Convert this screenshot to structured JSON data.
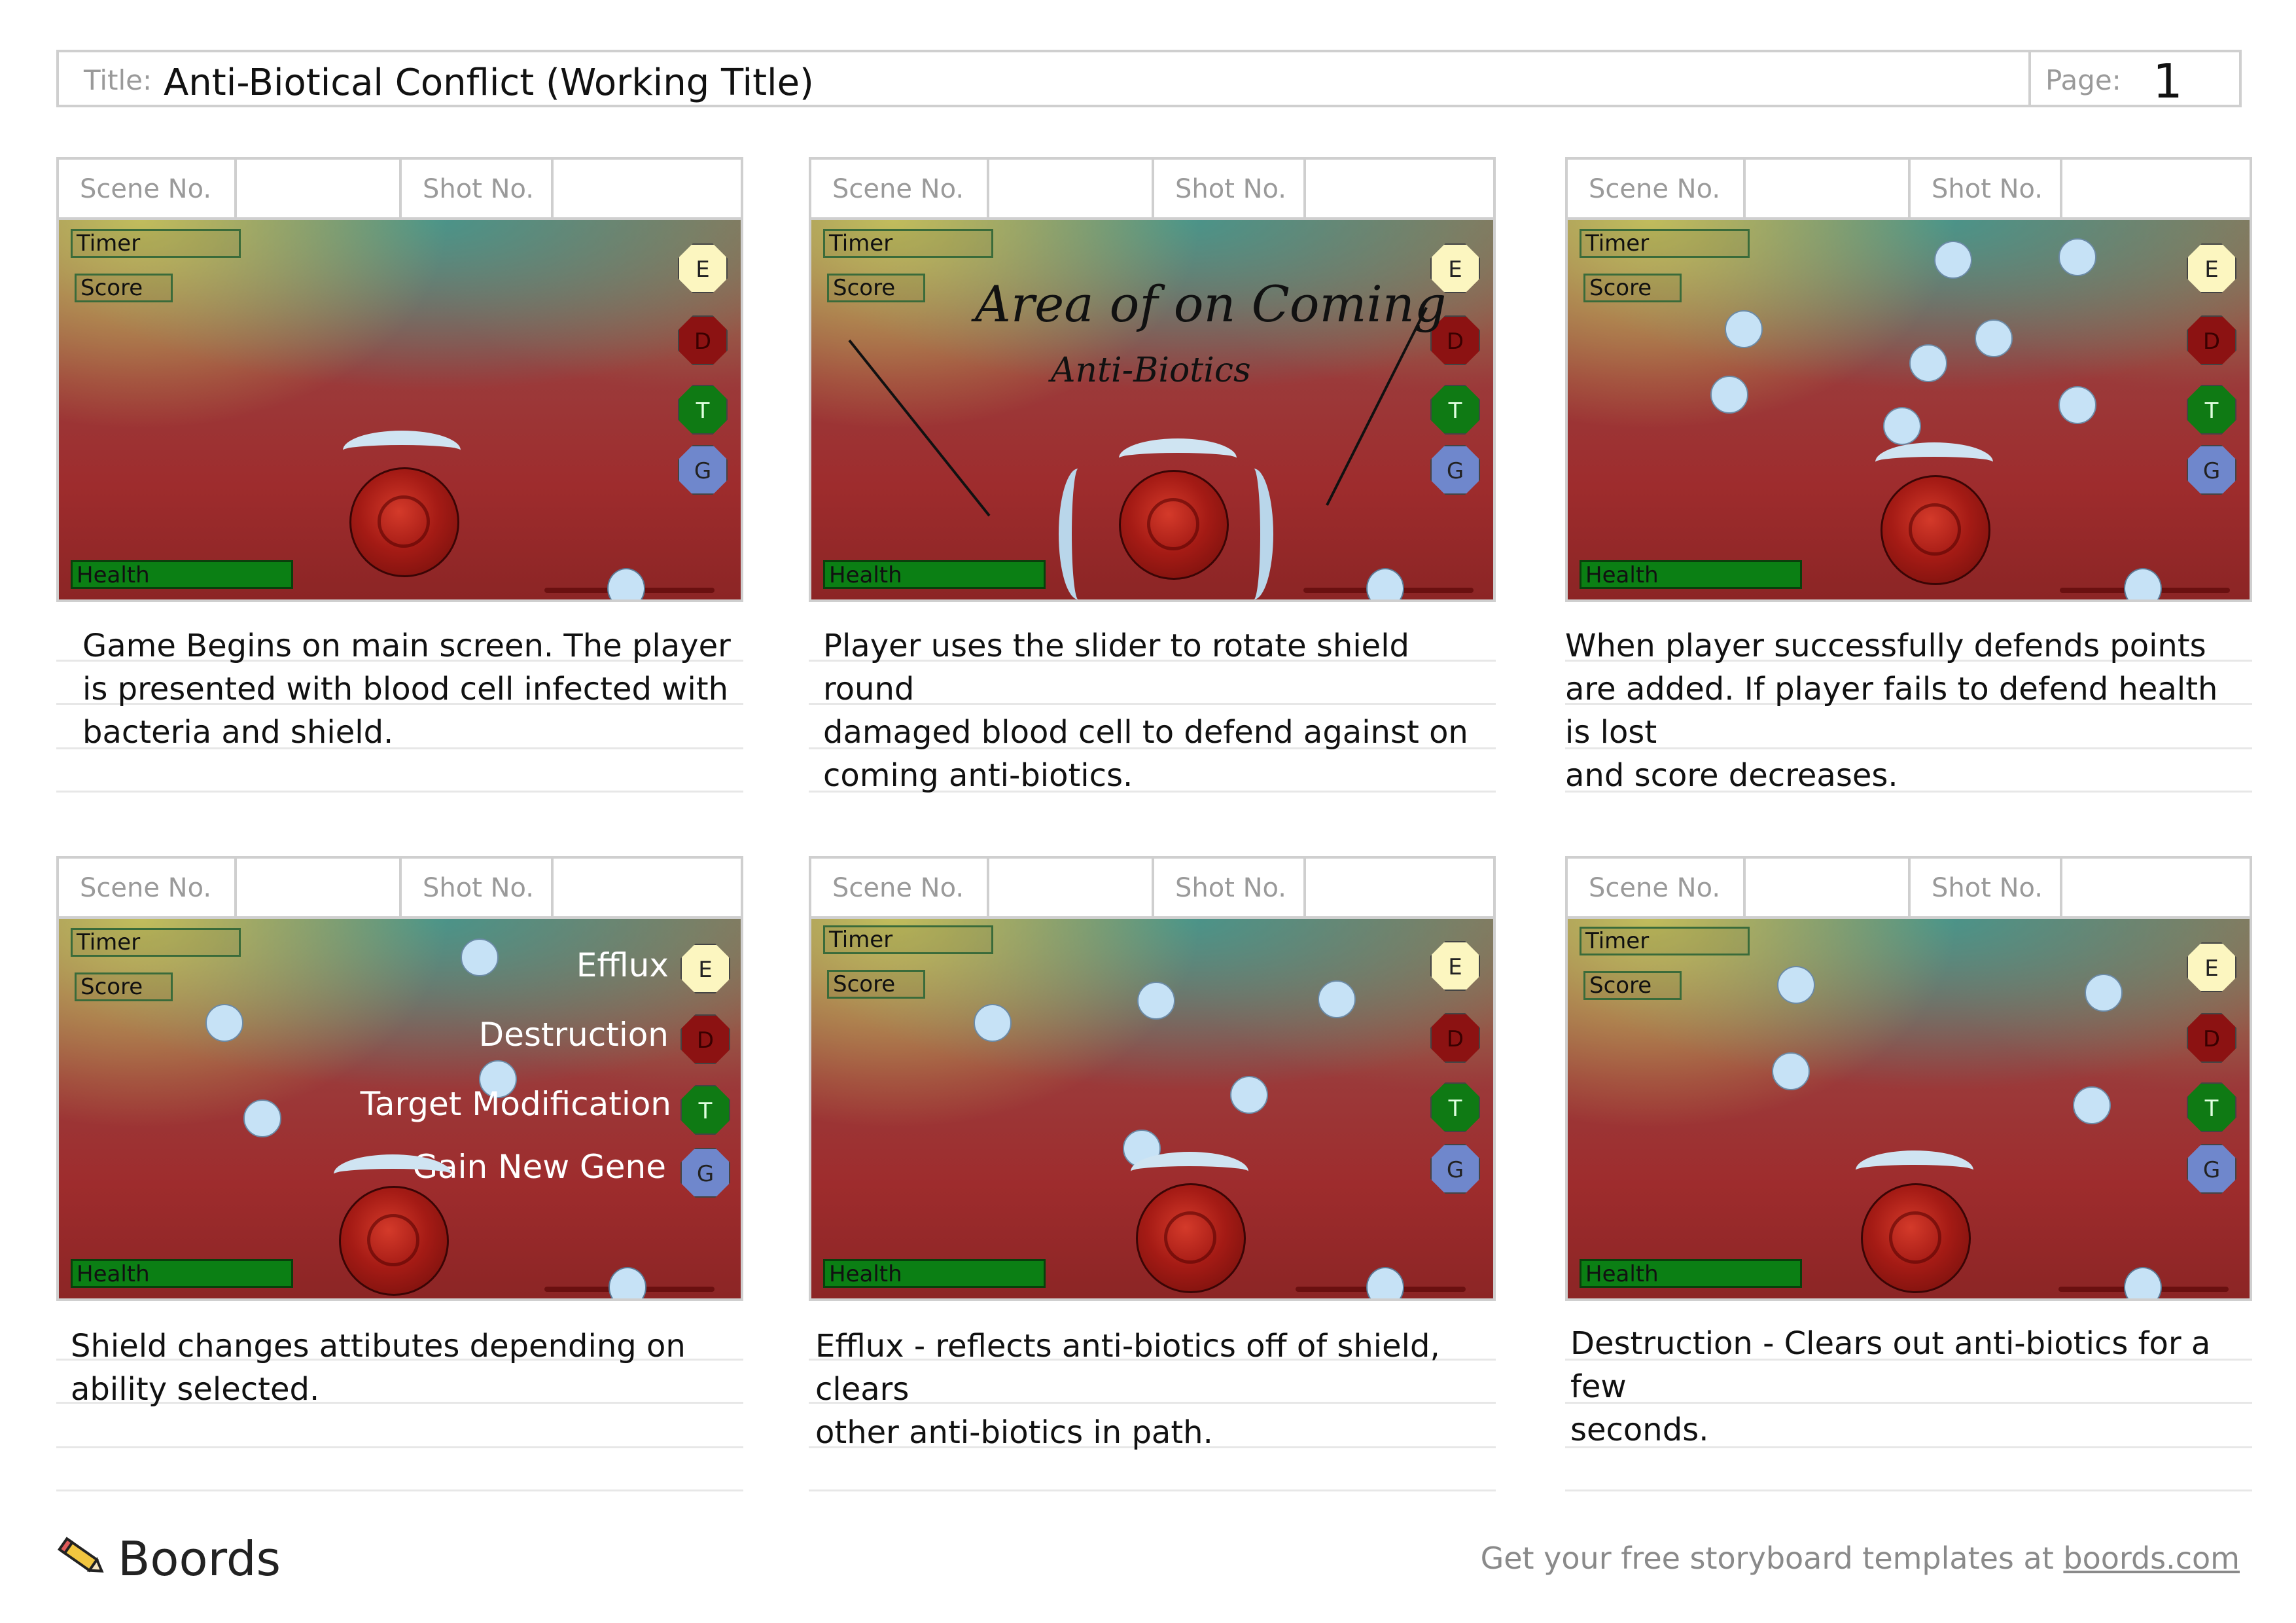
{
  "header": {
    "title_label": "Title:",
    "title": "Anti-Biotical Conflict (Working Title)",
    "page_label": "Page:",
    "page_number": "1"
  },
  "shot_header": {
    "scene_label": "Scene No.",
    "shot_label": "Shot No."
  },
  "hud": {
    "timer": "Timer",
    "score": "Score",
    "health": "Health",
    "btn_e": "E",
    "btn_d": "D",
    "btn_t": "T",
    "btn_g": "G"
  },
  "panels": [
    {
      "caption": [
        "Game Begins on main screen. The player",
        "is presented with blood cell infected with",
        "bacteria and shield."
      ]
    },
    {
      "caption": [
        "Player uses the slider to rotate shield round",
        "damaged blood cell to defend against on",
        "coming anti-biotics."
      ],
      "sketch_line1": "Area of on Coming",
      "sketch_line2": "Anti-Biotics"
    },
    {
      "caption": [
        "When player successfully defends points",
        "are added. If player fails to defend health is lost",
        "and score decreases."
      ]
    },
    {
      "caption": [
        "Shield changes attibutes depending on",
        "ability selected."
      ],
      "abilities": [
        "Efflux",
        "Destruction",
        "Target Modification",
        "Gain New Gene"
      ]
    },
    {
      "caption": [
        "Efflux - reflects anti-biotics off of shield, clears",
        "other anti-biotics in path."
      ]
    },
    {
      "caption": [
        "Destruction - Clears out anti-biotics for a few",
        "seconds."
      ]
    }
  ],
  "footer": {
    "brand": "Boords",
    "promo_text": "Get your free storyboard templates at ",
    "promo_link": "boords.com"
  },
  "colors": {
    "border": "#cfcfcf",
    "health_bar": "#0b7f14",
    "ball": "#c6e2f6",
    "btn_e": "#fcf6c0",
    "btn_d": "#8c1212",
    "btn_t": "#0f7a14",
    "btn_g": "#6f87cc"
  }
}
